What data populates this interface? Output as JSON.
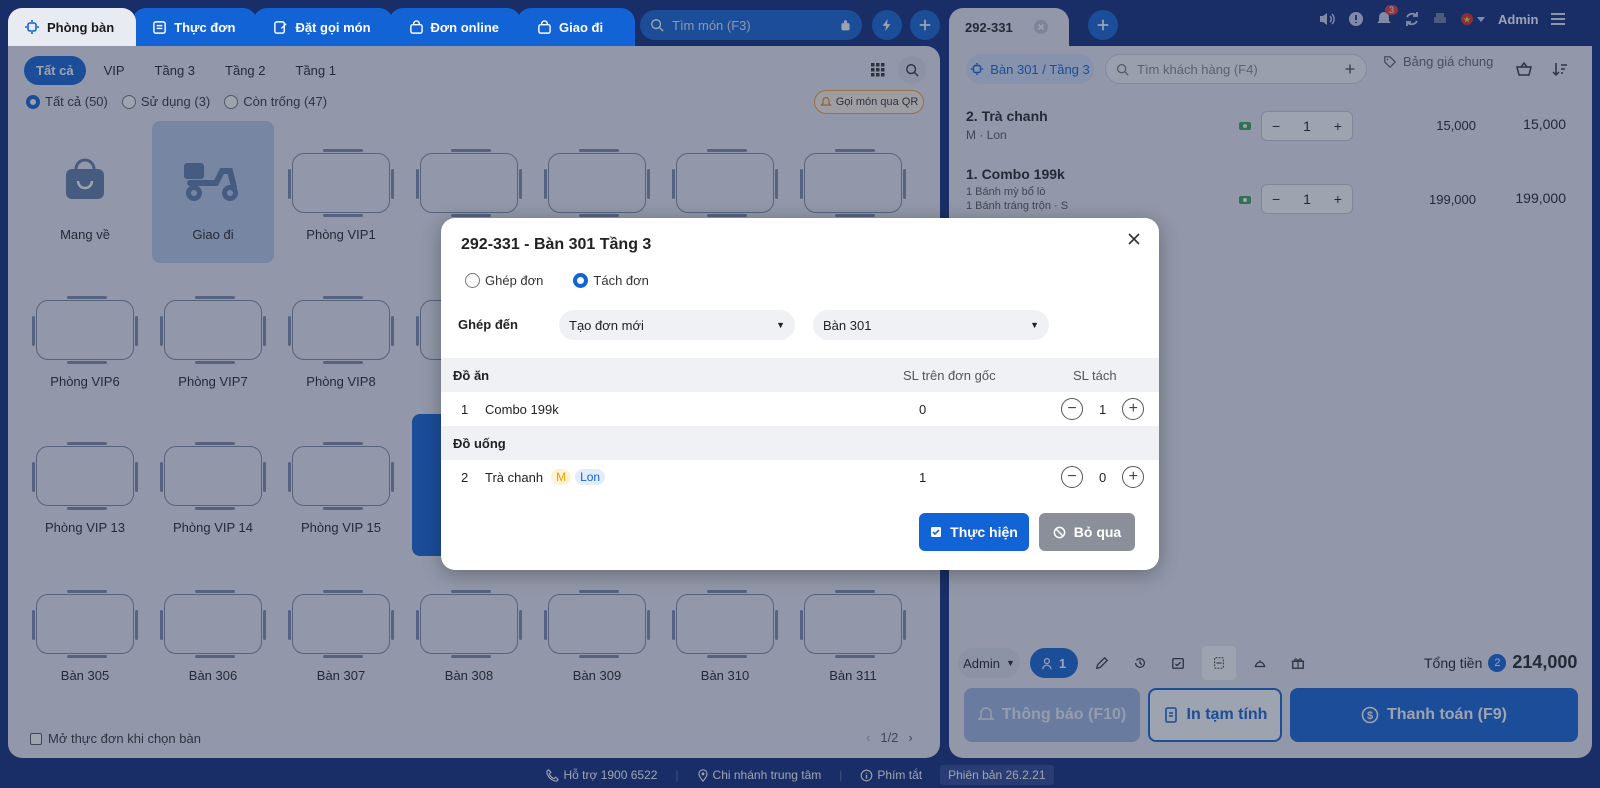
{
  "top_tabs": [
    {
      "label": "Phòng bàn",
      "icon": "table-icon"
    },
    {
      "label": "Thực đơn",
      "icon": "menu-icon"
    },
    {
      "label": "Đặt gọi món",
      "icon": "order-icon"
    },
    {
      "label": "Đơn online",
      "icon": "bag-icon"
    },
    {
      "label": "Giao đi",
      "icon": "bag-icon"
    }
  ],
  "search": {
    "placeholder": "Tìm món (F3)"
  },
  "floors": [
    "Tất cả",
    "VIP",
    "Tầng 3",
    "Tầng 2",
    "Tầng 1"
  ],
  "filters": [
    {
      "label": "Tất cả (50)",
      "selected": true
    },
    {
      "label": "Sử dụng (3)",
      "selected": false
    },
    {
      "label": "Còn trống (47)",
      "selected": false
    }
  ],
  "qr_button": "Gọi món qua QR",
  "tiles": {
    "row1": [
      "Mang về",
      "Giao đi",
      "Phòng VIP1",
      "",
      "",
      "",
      ""
    ],
    "row2": [
      "Phòng VIP6",
      "Phòng VIP7",
      "Phòng VIP8",
      ""
    ],
    "row3": [
      "Phòng VIP 13",
      "Phòng VIP 14",
      "Phòng VIP 15",
      ""
    ],
    "row4": [
      "Bàn 305",
      "Bàn 306",
      "Bàn 307",
      "Bàn 308",
      "Bàn 309",
      "Bàn 310",
      "Bàn 311"
    ]
  },
  "open_menu_option": "Mở thực đơn khi chọn bàn",
  "pager": "1/2",
  "right": {
    "order_tab": "292-331",
    "admin": "Admin",
    "notif_count": "3",
    "table_pill": "Bàn 301 / Tầng 3",
    "customer_placeholder": "Tìm khách hàng (F4)",
    "price_list": "Bảng giá chung",
    "items": [
      {
        "name": "2. Trà chanh",
        "sub1": "M · Lon",
        "sub2": "",
        "qty": "1",
        "price": "15,000",
        "total": "15,000"
      },
      {
        "name": "1. Combo 199k",
        "sub1": "1 Bánh mỳ bổ lò",
        "sub2": "1 Bánh tráng trộn ·  S",
        "qty": "1",
        "price": "199,000",
        "total": "199,000"
      }
    ],
    "staff": "Admin",
    "guest_count": "1",
    "total_label": "Tổng tiền",
    "total_badge": "2",
    "total_value": "214,000",
    "notify_btn": "Thông báo (F10)",
    "print_btn": "In tạm tính",
    "pay_btn": "Thanh toán (F9)"
  },
  "status": {
    "support": "Hỗ trợ 1900 6522",
    "branch": "Chi nhánh trung tâm",
    "shortcuts": "Phím tắt",
    "version": "Phiên bản 26.2.21"
  },
  "modal": {
    "title": "292-331 - Bàn 301 Tầng 3",
    "merge_label": "Ghép đơn",
    "split_label": "Tách đơn",
    "target_label": "Ghép đến",
    "target_order": "Tạo đơn mới",
    "target_table": "Bàn 301",
    "col_group": "Đồ ăn",
    "col_orig": "SL trên đơn gốc",
    "col_split": "SL tách",
    "group2": "Đồ uống",
    "rows": [
      {
        "no": "1",
        "name": "Combo 199k",
        "orig": "0",
        "split": "1"
      },
      {
        "no": "2",
        "name": "Trà chanh",
        "tag1": "M",
        "tag2": "Lon",
        "orig": "1",
        "split": "0"
      }
    ],
    "confirm": "Thực hiện",
    "cancel": "Bỏ qua"
  }
}
